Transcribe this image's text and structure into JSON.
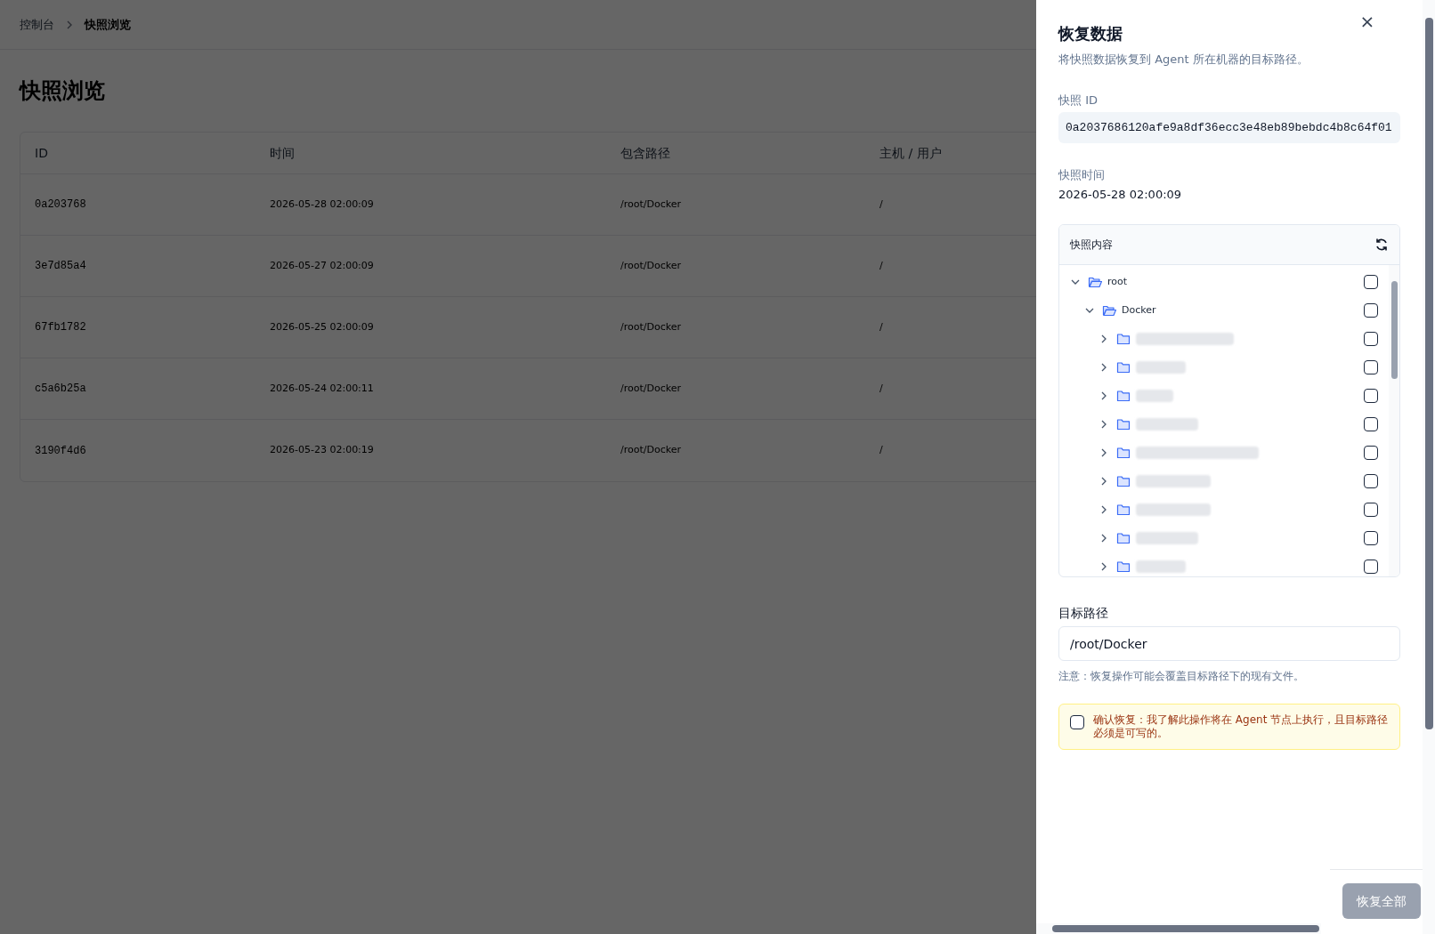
{
  "breadcrumb": [
    {
      "label": "控制台",
      "current": false
    },
    {
      "label": "快照浏览",
      "current": true
    }
  ],
  "page_title": "快照浏览",
  "table": {
    "columns": [
      "ID",
      "时间",
      "包含路径",
      "主机 / 用户"
    ],
    "rows": [
      {
        "id": "0a203768",
        "time": "2026-05-28 02:00:09",
        "paths": "/root/Docker",
        "host_user": "/"
      },
      {
        "id": "3e7d85a4",
        "time": "2026-05-27 02:00:09",
        "paths": "/root/Docker",
        "host_user": "/"
      },
      {
        "id": "67fb1782",
        "time": "2026-05-25 02:00:09",
        "paths": "/root/Docker",
        "host_user": "/"
      },
      {
        "id": "c5a6b25a",
        "time": "2026-05-24 02:00:11",
        "paths": "/root/Docker",
        "host_user": "/"
      },
      {
        "id": "3190f4d6",
        "time": "2026-05-23 02:00:19",
        "paths": "/root/Docker",
        "host_user": "/"
      }
    ]
  },
  "drawer": {
    "title": "恢复数据",
    "close": "×",
    "description": "将快照数据恢复到 Agent 所在机器的目标路径。",
    "snapshot_id_label": "快照 ID",
    "snapshot_id": "0a2037686120afe9a8df36ecc3e48eb89bebdc4b8c64f01",
    "snapshot_time_label": "快照时间",
    "snapshot_time": "2026-05-28 02:00:09",
    "tree": {
      "title": "快照内容",
      "items": [
        {
          "label": "root",
          "expanded": true,
          "checked": false,
          "children": [
            {
              "label": "Docker",
              "expanded": true,
              "checked": false,
              "children": [
                {
                  "expanded": false,
                  "checked": false,
                  "kind": "blurred"
                },
                {
                  "expanded": false,
                  "checked": false,
                  "kind": "blurred"
                },
                {
                  "expanded": false,
                  "checked": false,
                  "kind": "blurred"
                },
                {
                  "expanded": false,
                  "checked": false,
                  "kind": "blurred"
                },
                {
                  "expanded": false,
                  "checked": false,
                  "kind": "blurred"
                },
                {
                  "expanded": false,
                  "checked": false,
                  "kind": "blurred"
                },
                {
                  "expanded": false,
                  "checked": false,
                  "kind": "blurred"
                },
                {
                  "expanded": false,
                  "checked": false,
                  "kind": "blurred"
                },
                {
                  "expanded": false,
                  "checked": false,
                  "kind": "blurred"
                }
              ]
            }
          ]
        }
      ]
    },
    "target_label": "目标路径",
    "target_path": "/root/Docker",
    "note": "注意：恢复操作可能会覆盖目标路径下的现有文件。",
    "confirm": {
      "checked": false,
      "text": "确认恢复：我了解此操作将在 Agent 节点上执行，且目标路径必须是可写的。"
    },
    "submit": {
      "label": "恢复全部",
      "disabled": true
    }
  }
}
